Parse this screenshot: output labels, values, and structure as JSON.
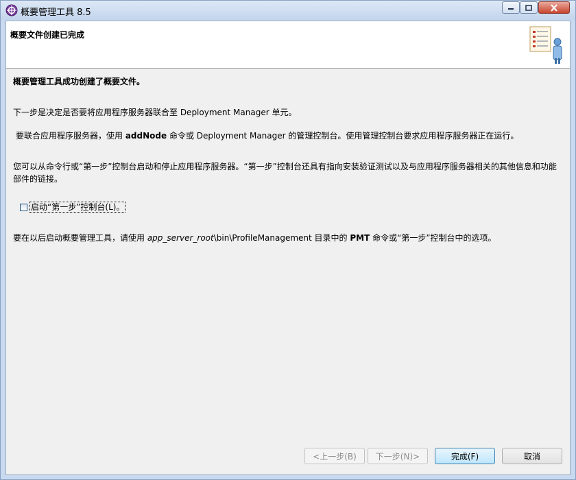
{
  "window": {
    "title": "概要管理工具 8.5",
    "controls": {
      "minimize_icon": "minimize-icon",
      "maximize_icon": "maximize-icon",
      "close_icon": "close-icon"
    }
  },
  "banner": {
    "title": "概要文件创建已完成",
    "icon": "checklist-person-icon"
  },
  "content": {
    "success_line": "概要管理工具成功创建了概要文件。",
    "next_step": "下一步是决定是否要将应用程序服务器联合至 Deployment Manager 单元。",
    "federate": {
      "pre": "要联合应用程序服务器，使用 ",
      "command": "addNode",
      "post": " 命令或 Deployment Manager 的管理控制台。使用管理控制台要求应用程序服务器正在运行。"
    },
    "first_steps_info": "您可以从命令行或“第一步”控制台启动和停止应用程序服务器。“第一步”控制台还具有指向安装验证测试以及与应用程序服务器相关的其他信息和功能部件的链接。",
    "checkbox": {
      "label": "启动“第一步”控制台(L)。",
      "checked": false
    },
    "restart": {
      "pre": "要在以后启动概要管理工具，请使用 ",
      "path_italic": "app_server_root",
      "path_rest": "\\bin\\ProfileManagement 目录中的 ",
      "command": "PMT",
      "post": " 命令或“第一步”控制台中的选项。"
    }
  },
  "buttons": {
    "back": "<上一步(B)",
    "next": "下一步(N)>",
    "finish": "完成(F)",
    "cancel": "取消"
  }
}
